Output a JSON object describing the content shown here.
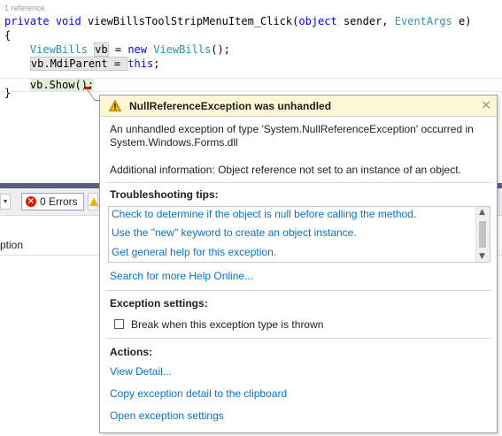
{
  "editor": {
    "codelens": "1 reference",
    "signature": {
      "kw1": "private",
      "kw2": "void",
      "name": "viewBillsToolStripMenuItem_Click(",
      "kw3": "object",
      "mid": " sender, ",
      "type": "EventArgs",
      "end": " e)"
    },
    "open_brace": "{",
    "line1": {
      "type": "ViewBills",
      "var": "vb",
      "eq": " = ",
      "kw": "new",
      "ctor": "ViewBills",
      "end": "();"
    },
    "line2": {
      "text": "vb.MdiParent = ",
      "kw": "this",
      "end": ";"
    },
    "line3": {
      "text": "vb.Show();"
    },
    "close_brace": "}"
  },
  "error_list": {
    "dropdown_glyph": "▾",
    "errors_label": "0 Errors",
    "error_glyph": "×",
    "column_header": "ption"
  },
  "exception": {
    "title": "NullReferenceException was unhandled",
    "close_glyph": "×",
    "description": "An unhandled exception of type 'System.NullReferenceException' occurred in System.Windows.Forms.dll",
    "additional_info": "Additional information: Object reference not set to an instance of an object.",
    "tips_heading": "Troubleshooting tips:",
    "tips": [
      "Check to determine if the object is null before calling the method.",
      "Use the \"new\" keyword to create an object instance.",
      "Get general help for this exception."
    ],
    "scroll_up": "▲",
    "scroll_down": "▼",
    "search_link": "Search for more Help Online...",
    "settings_heading": "Exception settings:",
    "break_label": "Break when this exception type is thrown",
    "actions_heading": "Actions:",
    "actions": [
      "View Detail...",
      "Copy exception detail to the clipboard",
      "Open exception settings"
    ]
  },
  "colors": {
    "keyword": "#0000ff",
    "type": "#2b91af",
    "link": "#0e70c0",
    "title_bar": "#fef7d5",
    "error_red": "#e51400",
    "warning_yellow": "#f0b400"
  }
}
